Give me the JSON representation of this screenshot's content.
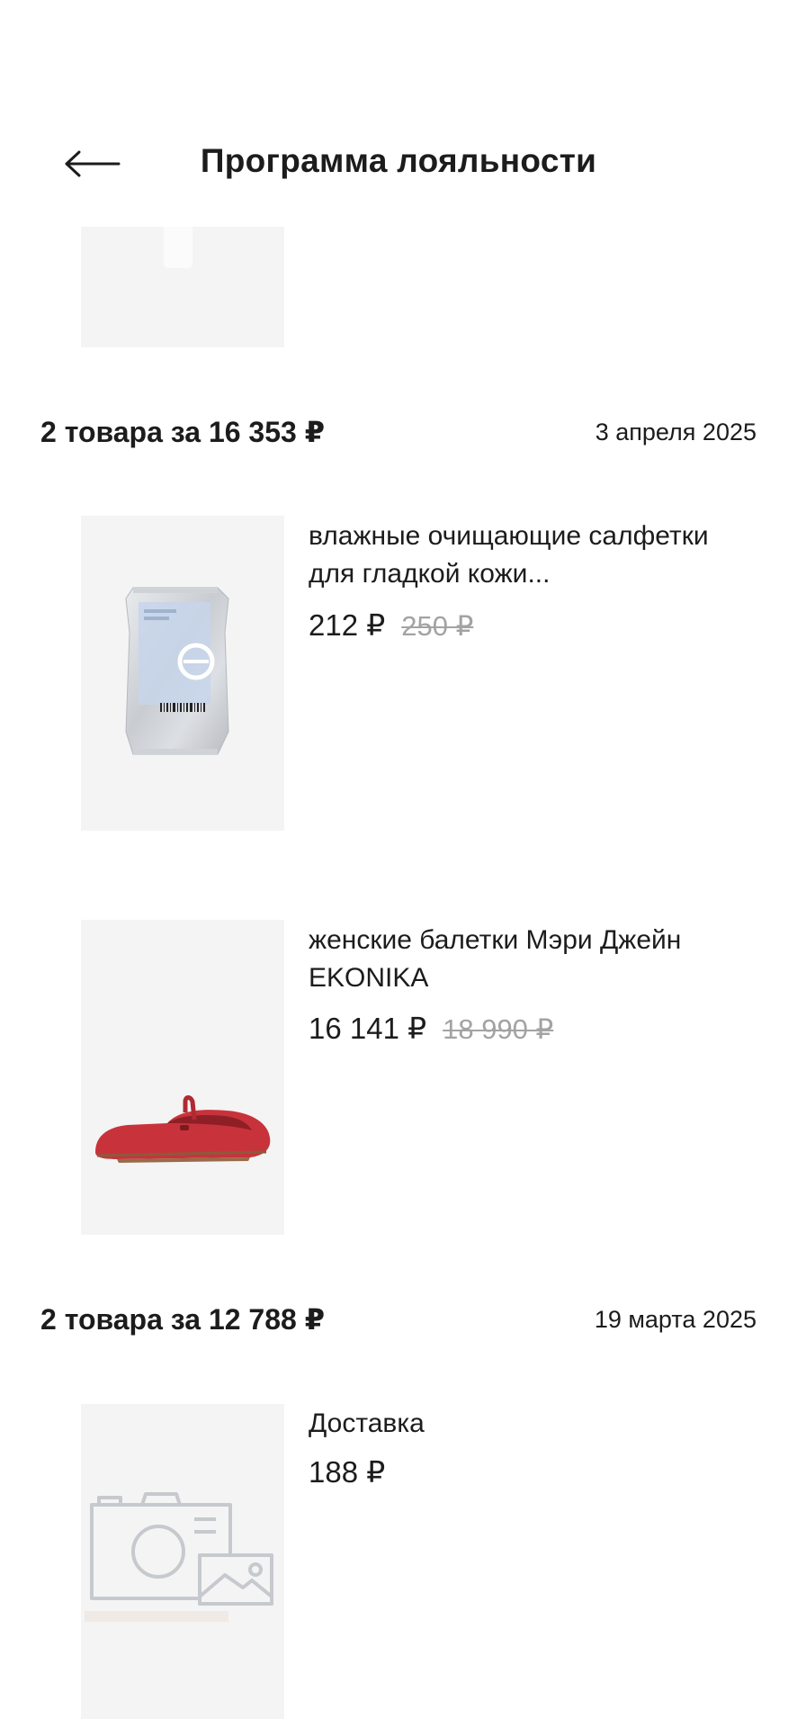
{
  "header": {
    "title": "Программа лояльности",
    "back_icon": "arrow-left-icon"
  },
  "orders": [
    {
      "summary": "2 товара за 16 353 ₽",
      "date": "3 апреля 2025",
      "items": [
        {
          "name": "влажные очищающие салфетки для гладкой кожи...",
          "price": "212 ₽",
          "old_price": "250 ₽",
          "image_icon": "wet-wipes-pack-image"
        },
        {
          "name": "женские балетки Мэри Джейн EKONIKA",
          "price": "16 141 ₽",
          "old_price": "18 990 ₽",
          "image_icon": "red-ballet-flat-image"
        }
      ]
    },
    {
      "summary": "2 товара за 12 788 ₽",
      "date": "19 марта 2025",
      "items": [
        {
          "name": "Доставка",
          "price": "188 ₽",
          "image_icon": "photo-placeholder-icon"
        }
      ]
    }
  ],
  "colors": {
    "text": "#1c1c1c",
    "old_price": "#a3a3a3",
    "thumb_bg": "#f4f4f4",
    "shoe_red": "#c8333b"
  }
}
